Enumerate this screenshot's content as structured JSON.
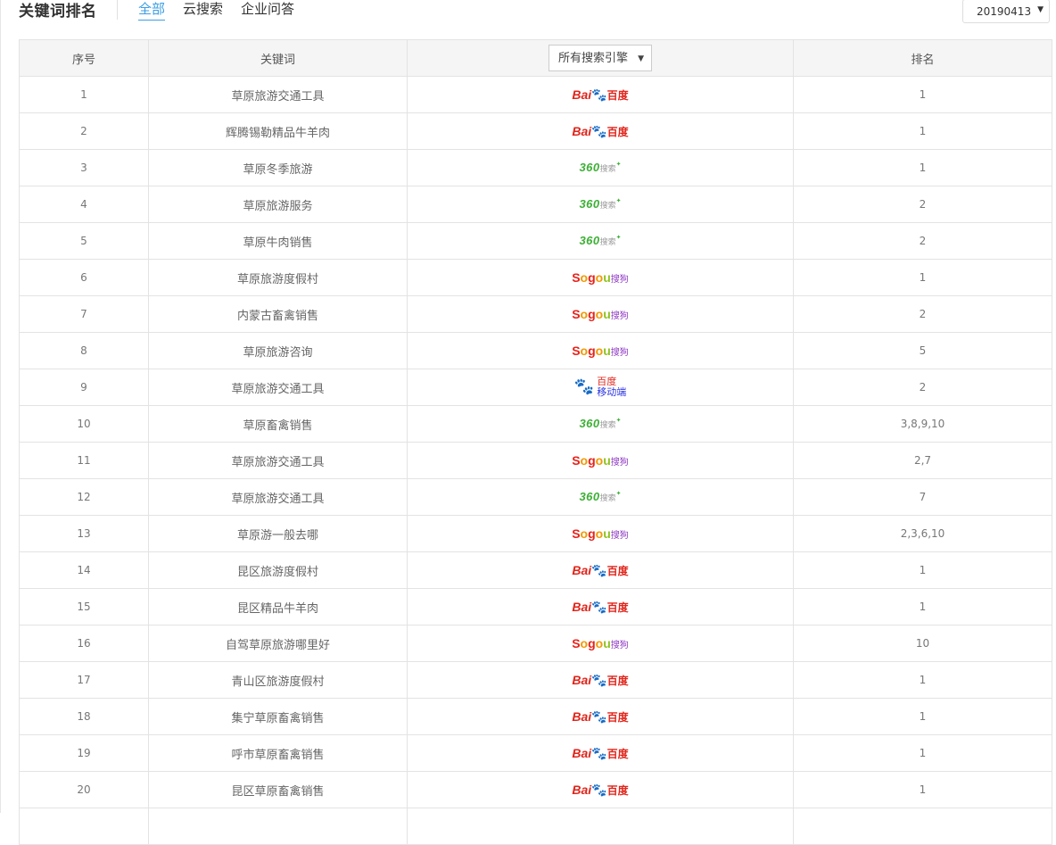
{
  "header": {
    "title": "关键词排名",
    "tabs": [
      {
        "label": "全部",
        "active": true
      },
      {
        "label": "云搜索",
        "active": false
      },
      {
        "label": "企业问答",
        "active": false
      }
    ],
    "date_select": {
      "value": "20190413"
    }
  },
  "table": {
    "columns": {
      "index": "序号",
      "keyword": "关键词",
      "engine_filter": "所有搜索引擎",
      "rank": "排名"
    },
    "engines": {
      "baidu": {
        "text_a": "Bai",
        "text_b": "百度",
        "icon": "baidu-paw-icon"
      },
      "so360": {
        "text_a": "360",
        "text_b": "搜索",
        "icon": "360-star-icon"
      },
      "sogou": {
        "text_a": "Sogou",
        "text_b": "搜狗"
      },
      "baidu_mobile": {
        "text_a": "百度",
        "text_b": "移动端",
        "icon": "baidu-paw-icon"
      }
    },
    "accent_color": "#3a9ee4",
    "rows": [
      {
        "num": "1",
        "keyword": "草原旅游交通工具",
        "engine": "baidu",
        "rank": "1"
      },
      {
        "num": "2",
        "keyword": "辉腾锡勒精品牛羊肉",
        "engine": "baidu",
        "rank": "1"
      },
      {
        "num": "3",
        "keyword": "草原冬季旅游",
        "engine": "so360",
        "rank": "1"
      },
      {
        "num": "4",
        "keyword": "草原旅游服务",
        "engine": "so360",
        "rank": "2"
      },
      {
        "num": "5",
        "keyword": "草原牛肉销售",
        "engine": "so360",
        "rank": "2"
      },
      {
        "num": "6",
        "keyword": "草原旅游度假村",
        "engine": "sogou",
        "rank": "1"
      },
      {
        "num": "7",
        "keyword": "内蒙古畜禽销售",
        "engine": "sogou",
        "rank": "2"
      },
      {
        "num": "8",
        "keyword": "草原旅游咨询",
        "engine": "sogou",
        "rank": "5"
      },
      {
        "num": "9",
        "keyword": "草原旅游交通工具",
        "engine": "baidu_mobile",
        "rank": "2"
      },
      {
        "num": "10",
        "keyword": "草原畜禽销售",
        "engine": "so360",
        "rank": "3,8,9,10"
      },
      {
        "num": "11",
        "keyword": "草原旅游交通工具",
        "engine": "sogou",
        "rank": "2,7"
      },
      {
        "num": "12",
        "keyword": "草原旅游交通工具",
        "engine": "so360",
        "rank": "7"
      },
      {
        "num": "13",
        "keyword": "草原游一般去哪",
        "engine": "sogou",
        "rank": "2,3,6,10"
      },
      {
        "num": "14",
        "keyword": "昆区旅游度假村",
        "engine": "baidu",
        "rank": "1"
      },
      {
        "num": "15",
        "keyword": "昆区精品牛羊肉",
        "engine": "baidu",
        "rank": "1"
      },
      {
        "num": "16",
        "keyword": "自驾草原旅游哪里好",
        "engine": "sogou",
        "rank": "10"
      },
      {
        "num": "17",
        "keyword": "青山区旅游度假村",
        "engine": "baidu",
        "rank": "1"
      },
      {
        "num": "18",
        "keyword": "集宁草原畜禽销售",
        "engine": "baidu",
        "rank": "1"
      },
      {
        "num": "19",
        "keyword": "呼市草原畜禽销售",
        "engine": "baidu",
        "rank": "1"
      },
      {
        "num": "20",
        "keyword": "昆区草原畜禽销售",
        "engine": "baidu",
        "rank": "1"
      }
    ]
  }
}
